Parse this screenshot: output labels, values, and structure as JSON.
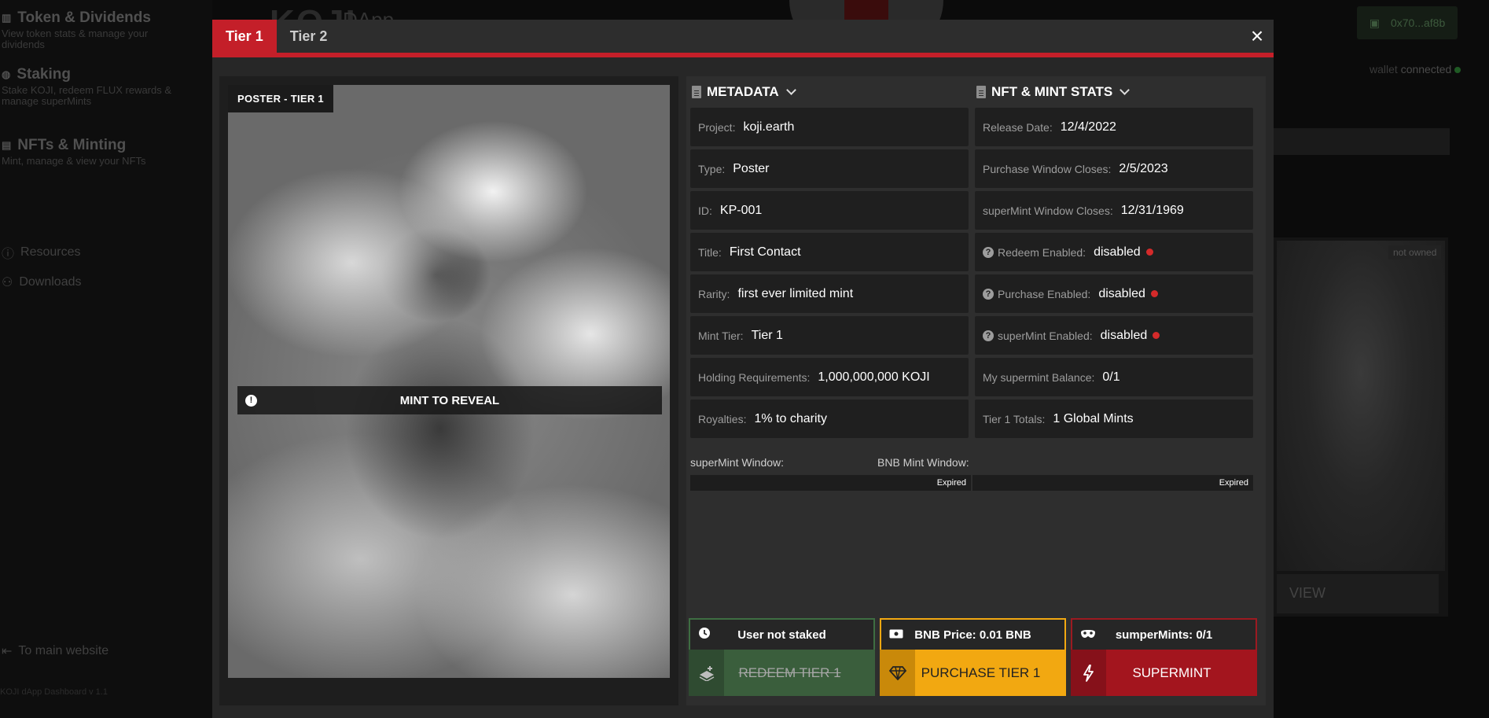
{
  "background": {
    "sidebar": {
      "items": [
        {
          "title": "Token & Dividends",
          "subtitle": "View token stats & manage your dividends"
        },
        {
          "title": "Staking",
          "subtitle": "Stake KOJI, redeem FLUX rewards & manage superMints"
        },
        {
          "title": "NFTs & Minting",
          "subtitle": "Mint, manage & view your NFTs"
        }
      ],
      "links": [
        "Resources",
        "Downloads"
      ],
      "main_site": "To main website",
      "footer": "KOJI dApp Dashboard v 1.1"
    },
    "logo": "KOJI",
    "logo_sub": "DApp",
    "wallet_address": "0x70...af8b",
    "wallet_label": "wallet",
    "wallet_status": "connected",
    "card_badge": "not owned",
    "card_button": "VIEW"
  },
  "modal": {
    "tabs": [
      {
        "label": "Tier 1",
        "active": true
      },
      {
        "label": "Tier 2",
        "active": false
      }
    ],
    "close_label": "×",
    "poster_label": "POSTER - TIER 1",
    "reveal_text": "MINT TO REVEAL",
    "metadata": {
      "heading": "METADATA",
      "fields": [
        {
          "label": "Project:",
          "value": "koji.earth"
        },
        {
          "label": "Type:",
          "value": "Poster"
        },
        {
          "label": "ID:",
          "value": "KP-001"
        },
        {
          "label": "Title:",
          "value": "First Contact"
        },
        {
          "label": "Rarity:",
          "value": "first ever limited mint"
        },
        {
          "label": "Mint Tier:",
          "value": "Tier 1"
        },
        {
          "label": "Holding Requirements:",
          "value": "1,000,000,000 KOJI"
        },
        {
          "label": "Royalties:",
          "value": "1% to charity"
        }
      ]
    },
    "stats": {
      "heading": "NFT & MINT STATS",
      "fields": [
        {
          "label": "Release Date:",
          "value": "12/4/2022"
        },
        {
          "label": "Purchase Window Closes:",
          "value": "2/5/2023"
        },
        {
          "label": "superMint Window Closes:",
          "value": "12/31/1969"
        },
        {
          "label": "Redeem Enabled:",
          "value": "disabled"
        },
        {
          "label": "Purchase Enabled:",
          "value": "disabled"
        },
        {
          "label": "superMint Enabled:",
          "value": "disabled"
        },
        {
          "label": "My supermint Balance:",
          "value": "0/1"
        },
        {
          "label": "Tier 1 Totals:",
          "value": "1 Global Mints"
        }
      ]
    },
    "windows": {
      "supermint_label": "superMint Window:",
      "bnb_label": "BNB Mint Window:",
      "supermint_status": "Expired",
      "bnb_status": "Expired"
    },
    "actions": {
      "redeem": {
        "status": "User not staked",
        "button": "REDEEM TIER 1"
      },
      "purchase": {
        "status": "BNB Price: 0.01 BNB",
        "button": "PURCHASE TIER 1"
      },
      "supermint": {
        "status": "sumperMints: 0/1",
        "button": "SUPERMINT"
      }
    }
  },
  "colors": {
    "accent_red": "#c41f29",
    "redeem_green": "#3a5e3c",
    "purchase_yellow": "#f2a811",
    "supermint_red": "#a3151e",
    "status_dot": "#d42a2a"
  }
}
